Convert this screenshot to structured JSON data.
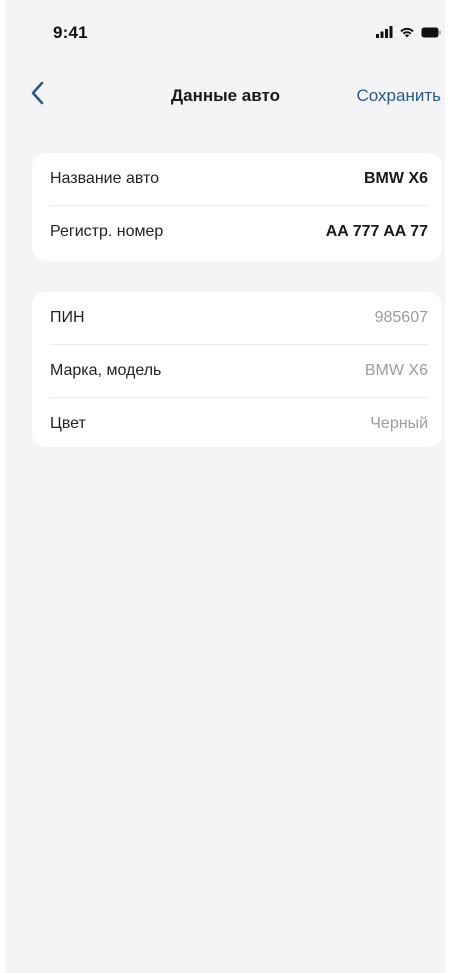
{
  "status_bar": {
    "time": "9:41",
    "icons": [
      "signal-icon",
      "wifi-icon",
      "battery-icon"
    ]
  },
  "nav": {
    "back_icon": "chevron-left-icon",
    "title": "Данные авто",
    "save_label": "Сохранить"
  },
  "colors": {
    "accent": "#2a5a86",
    "background": "#f4f4f6",
    "card": "#ffffff",
    "muted_text": "#9b9ba1"
  },
  "editable_section": {
    "rows": [
      {
        "label": "Название авто",
        "value": "BMW X6"
      },
      {
        "label": "Регистр. номер",
        "value": "AA 777 AA 77"
      }
    ]
  },
  "readonly_section": {
    "rows": [
      {
        "label": "ПИН",
        "value": "985607"
      },
      {
        "label": "Марка, модель",
        "value": "BMW X6"
      },
      {
        "label": "Цвет",
        "value": "Черный"
      }
    ]
  }
}
